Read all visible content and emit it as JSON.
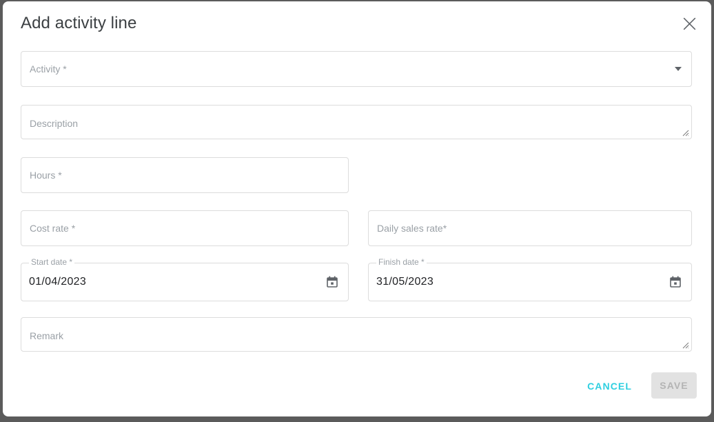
{
  "dialog": {
    "title": "Add activity line",
    "close_icon": "close-icon"
  },
  "fields": {
    "activity": {
      "placeholder": "Activity *",
      "value": "",
      "dropdown_icon": "chevron-down-icon"
    },
    "description": {
      "placeholder": "Description",
      "value": ""
    },
    "hours": {
      "placeholder": "Hours *",
      "value": ""
    },
    "cost_rate": {
      "placeholder": "Cost rate *",
      "value": ""
    },
    "daily_sales_rate": {
      "placeholder": "Daily sales rate*",
      "value": ""
    },
    "start_date": {
      "label": "Start date *",
      "value": "01/04/2023",
      "calendar_icon": "calendar-icon"
    },
    "finish_date": {
      "label": "Finish date *",
      "value": "31/05/2023",
      "calendar_icon": "calendar-icon"
    },
    "remark": {
      "placeholder": "Remark",
      "value": ""
    }
  },
  "footer": {
    "cancel_label": "CANCEL",
    "save_label": "SAVE"
  },
  "colors": {
    "accent": "#2ecfe0",
    "backdrop": "#5b5b5b",
    "surface": "#ffffff",
    "border": "#dcdcdc",
    "placeholder": "#9aa0a6",
    "title": "#3c4043",
    "save_disabled_bg": "#e2e2e2",
    "save_disabled_text": "#b4b4b4"
  }
}
